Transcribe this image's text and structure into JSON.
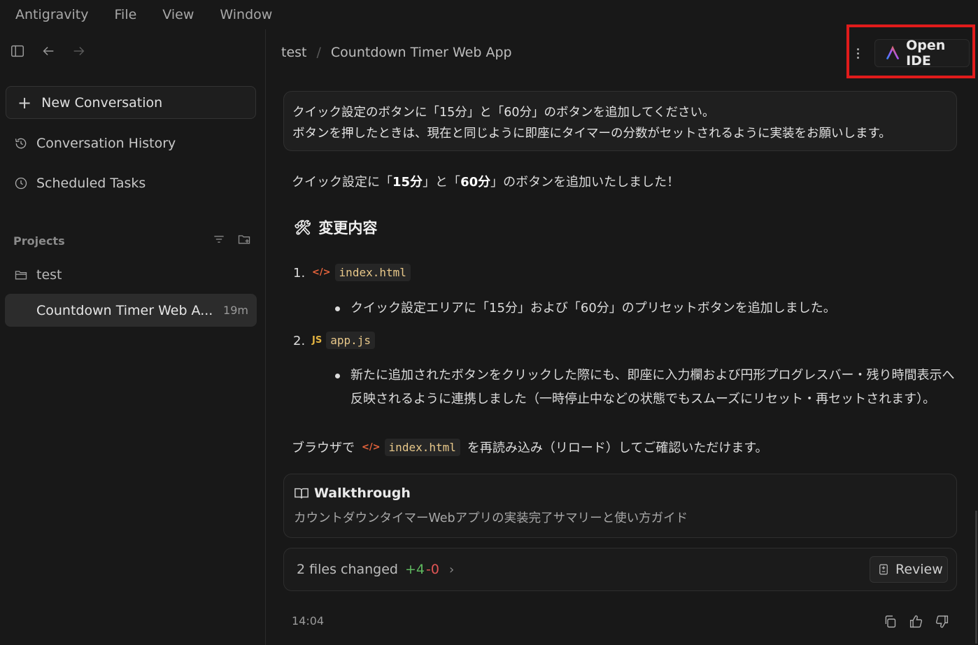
{
  "menu": [
    "Antigravity",
    "File",
    "View",
    "Window"
  ],
  "sidebar": {
    "new_conversation": "New Conversation",
    "history": "Conversation History",
    "scheduled": "Scheduled Tasks",
    "projects_label": "Projects",
    "project_name": "test",
    "conversation_title": "Countdown Timer Web A...",
    "conversation_time": "19m"
  },
  "header": {
    "breadcrumb_project": "test",
    "breadcrumb_sep": "/",
    "breadcrumb_title": "Countdown Timer Web App",
    "open_ide": "Open IDE"
  },
  "chat": {
    "user_line1": "クイック設定のボタンに「15分」と「60分」のボタンを追加してください。",
    "user_line2": "ボタンを押したときは、現在と同じように即座にタイマーの分数がセットされるように実装をお願いします。",
    "answer_pre": "クイック設定に「",
    "answer_b1": "15分",
    "answer_mid": "」と「",
    "answer_b2": "60分",
    "answer_post": "」のボタンを追加いたしました！",
    "heading_emoji": "🛠",
    "heading": "変更内容",
    "item1_num": "1.",
    "item1_icon": "</>",
    "item1_file": "index.html",
    "item1_bullet": "クイック設定エリアに「15分」および「60分」のプリセットボタンを追加しました。",
    "item2_num": "2.",
    "item2_icon": "JS",
    "item2_file": "app.js",
    "item2_bullet_l1": "新たに追加されたボタンをクリックした際にも、即座に入力欄および円形プログレスバー・残り時間表示へ",
    "item2_bullet_l2": "反映されるように連携しました（一時停止中などの状態でもスムーズにリセット・再セットされます）。",
    "reload_pre": "ブラウザで",
    "reload_icon": "</>",
    "reload_file": "index.html",
    "reload_post": "を再読み込み（リロード）してご確認いただけます。",
    "walk_title": "Walkthrough",
    "walk_desc": "カウントダウンタイマーWebアプリの実装完了サマリーと使い方ガイド",
    "files_changed": "2 files changed",
    "added": "+4",
    "removed": "-0",
    "review": "Review",
    "timestamp": "14:04"
  },
  "colors": {
    "highlight_box": "#e01b1b",
    "added": "#5fb95f",
    "removed": "#e05555",
    "html_icon": "#e8643c",
    "js_icon": "#e3b341"
  }
}
